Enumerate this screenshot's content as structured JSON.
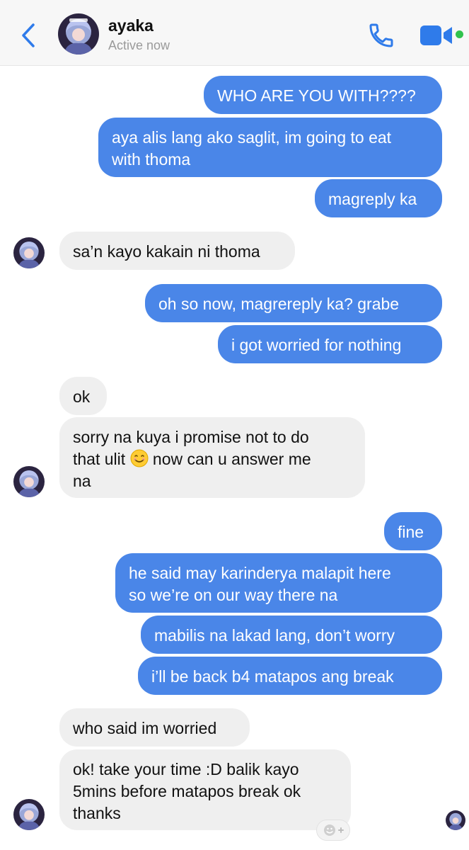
{
  "header": {
    "contact_name": "ayaka",
    "status": "Active now",
    "icons": {
      "back": "chevron-left-icon",
      "call": "phone-icon",
      "video": "video-camera-icon"
    },
    "accent_color": "#2f7bea",
    "online_color": "#31c24d"
  },
  "messages": [
    {
      "from": "me",
      "text": "WHO ARE YOU WITH????"
    },
    {
      "from": "me",
      "text": "aya alis lang ako saglit, im going to eat\nwith thoma"
    },
    {
      "from": "me",
      "text": "magreply ka"
    },
    {
      "from": "them",
      "text": "sa’n kayo kakain ni thoma"
    },
    {
      "from": "me",
      "text": "oh so now, magrereply ka? grabe"
    },
    {
      "from": "me",
      "text": "i got worried for nothing"
    },
    {
      "from": "them",
      "text": "ok"
    },
    {
      "from": "them",
      "text_part1": "sorry na kuya i promise not to do\nthat ulit ",
      "emoji": "smiling-face-icon",
      "text_part2": " now can u answer me\nna"
    },
    {
      "from": "me",
      "text": "fine"
    },
    {
      "from": "me",
      "text": "he said may karinderya malapit here\nso we’re on our way there na"
    },
    {
      "from": "me",
      "text": "mabilis na lakad lang, don’t worry"
    },
    {
      "from": "me",
      "text": "i’ll be back b4 matapos ang break"
    },
    {
      "from": "them",
      "text": "who said im worried"
    },
    {
      "from": "them",
      "text": "ok! take your time :D balik kayo\n5mins before matapos break ok\nthanks"
    }
  ],
  "colors": {
    "outgoing_bubble": "#4a86e8",
    "incoming_bubble": "#efefef"
  },
  "react_button_icon": "add-reaction-icon"
}
